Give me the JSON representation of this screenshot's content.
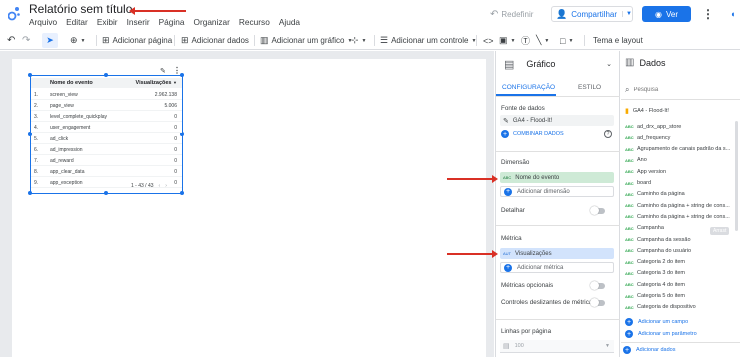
{
  "app": {
    "title": "Relatório sem título",
    "menu": [
      "Arquivo",
      "Editar",
      "Exibir",
      "Inserir",
      "Página",
      "Organizar",
      "Recurso",
      "Ajuda"
    ]
  },
  "header_actions": {
    "redo": "Redefinir",
    "share": "Compartilhar",
    "view": "Ver"
  },
  "toolbar": {
    "add_page": "Adicionar página",
    "add_data": "Adicionar dados",
    "add_chart": "Adicionar um gráfico",
    "add_control": "Adicionar um controle",
    "theme": "Tema e layout"
  },
  "table": {
    "headers": [
      "Nome do evento",
      "Visualizações"
    ],
    "rows": [
      {
        "idx": "1.",
        "name": "screen_view",
        "val": "2.962.138"
      },
      {
        "idx": "2.",
        "name": "page_view",
        "val": "5.006"
      },
      {
        "idx": "3.",
        "name": "level_complete_quickplay",
        "val": "0"
      },
      {
        "idx": "4.",
        "name": "user_engagement",
        "val": "0"
      },
      {
        "idx": "5.",
        "name": "ad_click",
        "val": "0"
      },
      {
        "idx": "6.",
        "name": "ad_impression",
        "val": "0"
      },
      {
        "idx": "7.",
        "name": "ad_reward",
        "val": "0"
      },
      {
        "idx": "8.",
        "name": "app_clear_data",
        "val": "0"
      },
      {
        "idx": "9.",
        "name": "app_exception",
        "val": "0"
      }
    ],
    "pagination": "1 - 43 / 43"
  },
  "config": {
    "header": "Gráfico",
    "tabs": [
      "CONFIGURAÇÃO",
      "ESTILO"
    ],
    "source_label": "Fonte de dados",
    "source_name": "GA4 - Flood-It!",
    "blend": "COMBINAR DADOS",
    "dimension_label": "Dimensão",
    "dimension_tag": "ABC",
    "dimension": "Nome do evento",
    "add_dimension": "Adicionar dimensão",
    "drill": "Detalhar",
    "metric_label": "Métrica",
    "metric_tag": "AUT",
    "metric": "Visualizações",
    "add_metric": "Adicionar métrica",
    "optional_metrics": "Métricas opcionais",
    "slider_metrics": "Controles deslizantes de métrica",
    "rows_per_page_label": "Linhas por página",
    "rows_per_page": "100"
  },
  "data_panel": {
    "header": "Dados",
    "search_placeholder": "Pesquisa",
    "source": "GA4 - Flood-It!",
    "fields": [
      "ad_drx_app_store",
      "ad_frequency",
      "Agrupamento de canais padrão da s...",
      "Ano",
      "App version",
      "board",
      "Caminho da página",
      "Caminho da página + string de cons...",
      "Caminho da página + string de cons...",
      "Campanha",
      "Campanha da sessão",
      "Campanha do usuário",
      "Categoria 2 do item",
      "Categoria 3 do item",
      "Categoria 4 do item",
      "Categoria 5 do item",
      "Categoria de dispositivo"
    ],
    "field_tag": "ABC",
    "hover_badge": "Arrast",
    "add_field": "Adicionar um campo",
    "add_param": "Adicionar um parâmetro",
    "add_data": "Adicionar dados"
  },
  "colors": {
    "accent": "#1a73e8",
    "annotation_arrow": "#d93025",
    "dimension_chip": "#ceead6",
    "metric_chip": "#d2e3fc"
  }
}
